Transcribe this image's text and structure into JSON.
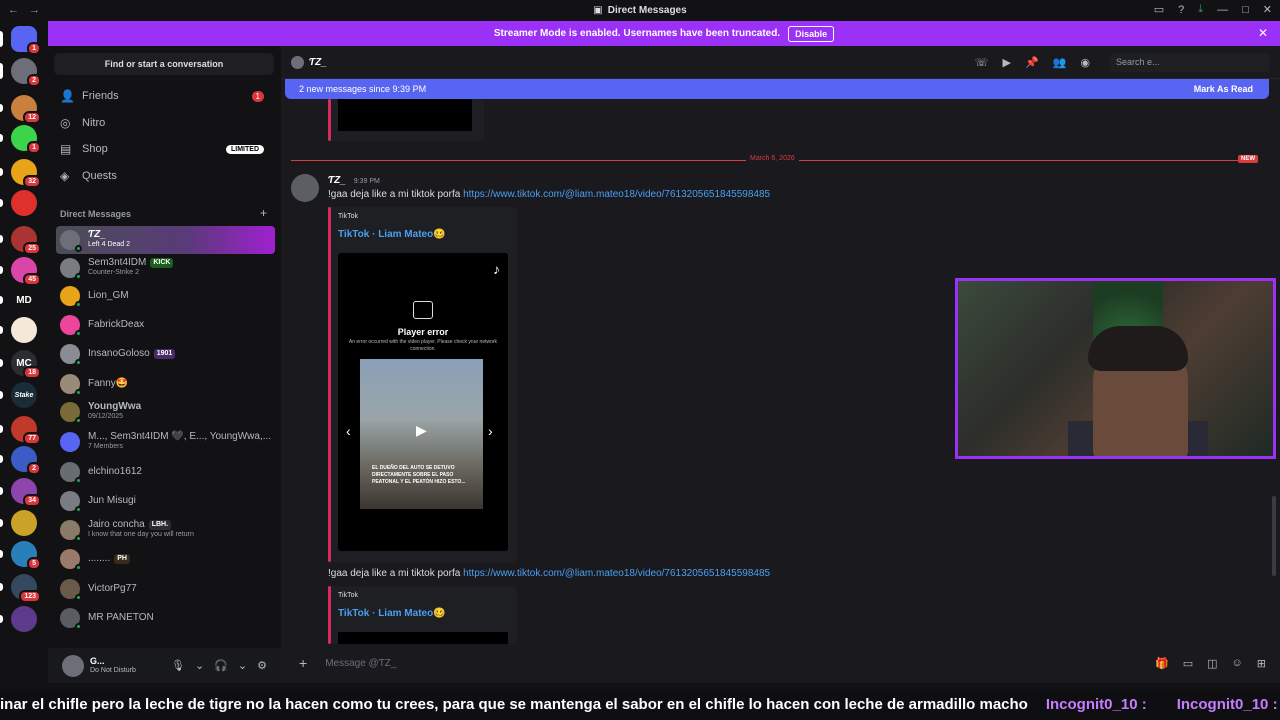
{
  "window": {
    "title": "Direct Messages"
  },
  "banner": {
    "text": "Streamer Mode is enabled. Usernames have been truncated.",
    "button": "Disable"
  },
  "servers": [
    {
      "label": "",
      "badge": "1",
      "color": "#5865f2"
    },
    {
      "label": "",
      "badge": "2",
      "color": "#6d6f78"
    },
    {
      "label": "",
      "badge": "12",
      "color": "#c9803f"
    },
    {
      "label": "",
      "badge": "1",
      "color": "#3bd44a"
    },
    {
      "label": "",
      "badge": "32",
      "color": "#e8a317"
    },
    {
      "label": "",
      "badge": "",
      "color": "#e0302d"
    },
    {
      "label": "",
      "badge": "25",
      "color": "#a33"
    },
    {
      "label": "",
      "badge": "45",
      "color": "#d946a8"
    },
    {
      "label": "MD",
      "badge": "",
      "color": "#121214"
    },
    {
      "label": "",
      "badge": "",
      "color": "#f4e9d8"
    },
    {
      "label": "MC",
      "badge": "18",
      "color": "#2b2d31"
    },
    {
      "label": "Stake",
      "badge": "",
      "color": "#1a2c38"
    },
    {
      "label": "",
      "badge": "77",
      "color": "#c0392b"
    },
    {
      "label": "",
      "badge": "2",
      "color": "#3b5cc4"
    },
    {
      "label": "",
      "badge": "34",
      "color": "#8e44ad"
    },
    {
      "label": "",
      "badge": "",
      "color": "#c9a227"
    },
    {
      "label": "",
      "badge": "5",
      "color": "#2980b9"
    },
    {
      "label": "",
      "badge": "123",
      "color": "#34495e"
    },
    {
      "label": "",
      "badge": "",
      "color": "#5d3a8a"
    }
  ],
  "sidebar": {
    "find": "Find or start a conversation",
    "nav": [
      {
        "label": "Friends",
        "count": "1",
        "limited": ""
      },
      {
        "label": "Nitro",
        "count": "",
        "limited": ""
      },
      {
        "label": "Shop",
        "count": "",
        "limited": "LIMITED"
      },
      {
        "label": "Quests",
        "count": "",
        "limited": ""
      }
    ],
    "dm_header": "Direct Messages",
    "dms": [
      {
        "name": "ƬZ_",
        "sub": "Left 4 Dead 2",
        "tag": "",
        "tag_color": "",
        "color": "#6d6f78",
        "status": "#23a55a"
      },
      {
        "name": "Sem3nt4IDM",
        "sub": "Counter-Strike 2",
        "tag": "KICK",
        "tag_color": "#1b5e20",
        "color": "#7a7c84",
        "status": "#23a55a"
      },
      {
        "name": "Lion_GM",
        "sub": "",
        "tag": "",
        "tag_color": "",
        "color": "#e8a317",
        "status": "#23a55a"
      },
      {
        "name": "FabrickDeax",
        "sub": "",
        "tag": "",
        "tag_color": "",
        "color": "#eb459e",
        "status": "#23a55a"
      },
      {
        "name": "InsanoGoloso",
        "sub": "",
        "tag": "1901",
        "tag_color": "#4a2a6a",
        "color": "#8a8c94",
        "status": "#23a55a"
      },
      {
        "name": "Fanny🤩",
        "sub": "",
        "tag": "",
        "tag_color": "",
        "color": "#9a8a7a",
        "status": "#23a55a"
      },
      {
        "name": "YoungWwa",
        "sub": "09/12/2025",
        "tag": "",
        "tag_color": "",
        "color": "#7a6a3a",
        "status": "#23a55a"
      },
      {
        "name": "M..., Sem3nt4IDM 🖤, E..., YoungWwa,...",
        "sub": "7 Members",
        "tag": "",
        "tag_color": "",
        "color": "#5865f2",
        "status": ""
      },
      {
        "name": "elchino1612",
        "sub": "",
        "tag": "",
        "tag_color": "",
        "color": "#6a6c74",
        "status": "#23a55a"
      },
      {
        "name": "Jun Misugi",
        "sub": "",
        "tag": "",
        "tag_color": "",
        "color": "#7a7c84",
        "status": "#23a55a"
      },
      {
        "name": "Jairo concha",
        "sub": "I know that one day you will return",
        "tag": "LBH.",
        "tag_color": "#2b2d31",
        "color": "#8a7a6a",
        "status": "#23a55a"
      },
      {
        "name": "........",
        "sub": "",
        "tag": "PH",
        "tag_color": "#3a2a1a",
        "color": "#9a7a6a",
        "status": "#23a55a"
      },
      {
        "name": "VictorPg77",
        "sub": "",
        "tag": "",
        "tag_color": "",
        "color": "#6a5a4a",
        "status": "#23a55a"
      },
      {
        "name": "MR PANETON",
        "sub": "",
        "tag": "",
        "tag_color": "",
        "color": "#5a5c64",
        "status": "#23a55a"
      }
    ]
  },
  "user": {
    "name": "G...",
    "status": "Do Not Disturb"
  },
  "chat": {
    "recipient": "ƬZ_",
    "search_placeholder": "Search e...",
    "new_messages": "2 new messages since 9:39 PM",
    "mark_read": "Mark As Read",
    "date_divider": "March 6, 2026",
    "new_label": "NEW",
    "author": "ƬZ_",
    "time": "9:39 PM",
    "messages": [
      {
        "text": "!gaa deja like a mi tiktok porfa ",
        "link": "https://www.tiktok.com/@liam.mateo18/video/7613205651845598485"
      },
      {
        "text": "!gaa deja like a mi tiktok porfa ",
        "link": "https://www.tiktok.com/@liam.mateo18/video/7613205651845598485"
      }
    ],
    "embed": {
      "provider": "TikTok",
      "title": "TikTok · Liam Mateo🥴",
      "error": "Player error",
      "error_sub": "An error occurred with the video player. Please check your network connection.",
      "caption": "EL DUEÑO DEL AUTO SE DETUVO DIRECTAMENTE SOBRE EL PASO PEATONAL Y EL PEATÓN HIZO ESTO..."
    },
    "composer_placeholder": "Message @ƬZ_"
  },
  "ticker": {
    "text": "inar el chifle pero la leche de tigre no la hacen como tu crees, para que se mantenga el sabor en el chifle lo hacen con leche de armadillo macho",
    "user1": "Incognit0_10 :",
    "user2": "Incognit0_10 :"
  }
}
